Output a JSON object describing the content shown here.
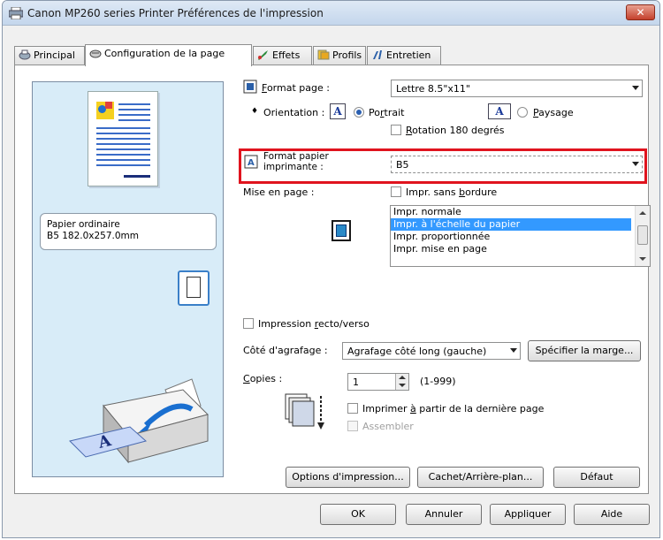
{
  "window": {
    "title": "Canon MP260 series Printer Préférences de l'impression",
    "close": "✕"
  },
  "tabs": [
    {
      "label": "Principal"
    },
    {
      "label": "Configuration de la page"
    },
    {
      "label": "Effets"
    },
    {
      "label": "Profils"
    },
    {
      "label": "Entretien"
    }
  ],
  "preview": {
    "media_line1": "Papier ordinaire",
    "media_line2": "B5 182.0x257.0mm"
  },
  "page_setup": {
    "format_label_underlined": "F",
    "format_label_rest": "ormat page :",
    "format_value": "Lettre 8.5\"x11\"",
    "orientation_label": "Orientation :",
    "portrait_pre": "Po",
    "portrait_underlined": "r",
    "portrait_post": "trait",
    "landscape_underlined": "P",
    "landscape_rest": "aysage",
    "rotation_underlined": "R",
    "rotation_rest": "otation 180 degrés",
    "printer_paper_label_line1": "Format papier",
    "printer_paper_label_line2": "imprimante :",
    "printer_paper_value": "B5",
    "layout_label": "Mise en page :",
    "borderless_pre": "Impr. sans ",
    "borderless_underlined": "b",
    "borderless_post": "ordure",
    "layout_options": [
      "Impr. normale",
      "Impr. à l'échelle du papier",
      "Impr. proportionnée",
      "Impr. mise en page"
    ],
    "duplex_pre": "Impression ",
    "duplex_underlined": "r",
    "duplex_post": "ecto/verso",
    "staple_label": "Côté d'agrafage :",
    "staple_value": "Agrafage côté long (gauche)",
    "margin_button": "Spécifier la marge...",
    "copies_label_underlined": "C",
    "copies_label_rest": "opies :",
    "copies_value": "1",
    "copies_range": "(1-999)",
    "print_last_pre": "Imprimer ",
    "print_last_underlined": "à",
    "print_last_post": " partir de la dernière page",
    "collate": "Assembler"
  },
  "panel_buttons": {
    "print_options": "Options d'impression...",
    "stamp_background": "Cachet/Arrière-plan...",
    "defaults": "Défaut"
  },
  "dialog_buttons": {
    "ok": "OK",
    "cancel": "Annuler",
    "apply": "Appliquer",
    "help": "Aide"
  },
  "colors": {
    "highlight": "#e0141e",
    "selection": "#3399ff",
    "preview_bg": "#d8ecf8"
  }
}
